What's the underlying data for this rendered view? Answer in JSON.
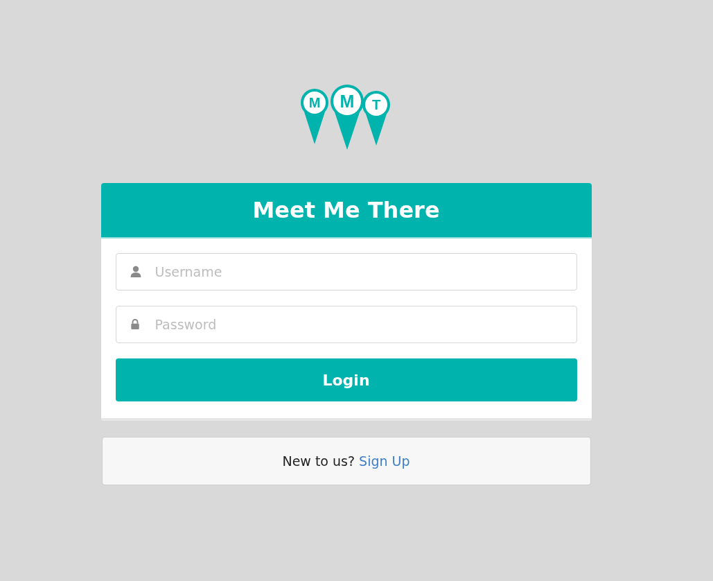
{
  "logo": {
    "letters": [
      "M",
      "M",
      "T"
    ]
  },
  "card": {
    "title": "Meet Me There",
    "fields": [
      {
        "kind": "user",
        "placeholder": "Username"
      },
      {
        "kind": "lock",
        "placeholder": "Password"
      }
    ],
    "button": "Login"
  },
  "footer": {
    "text": "New to us?",
    "link": "Sign Up"
  }
}
